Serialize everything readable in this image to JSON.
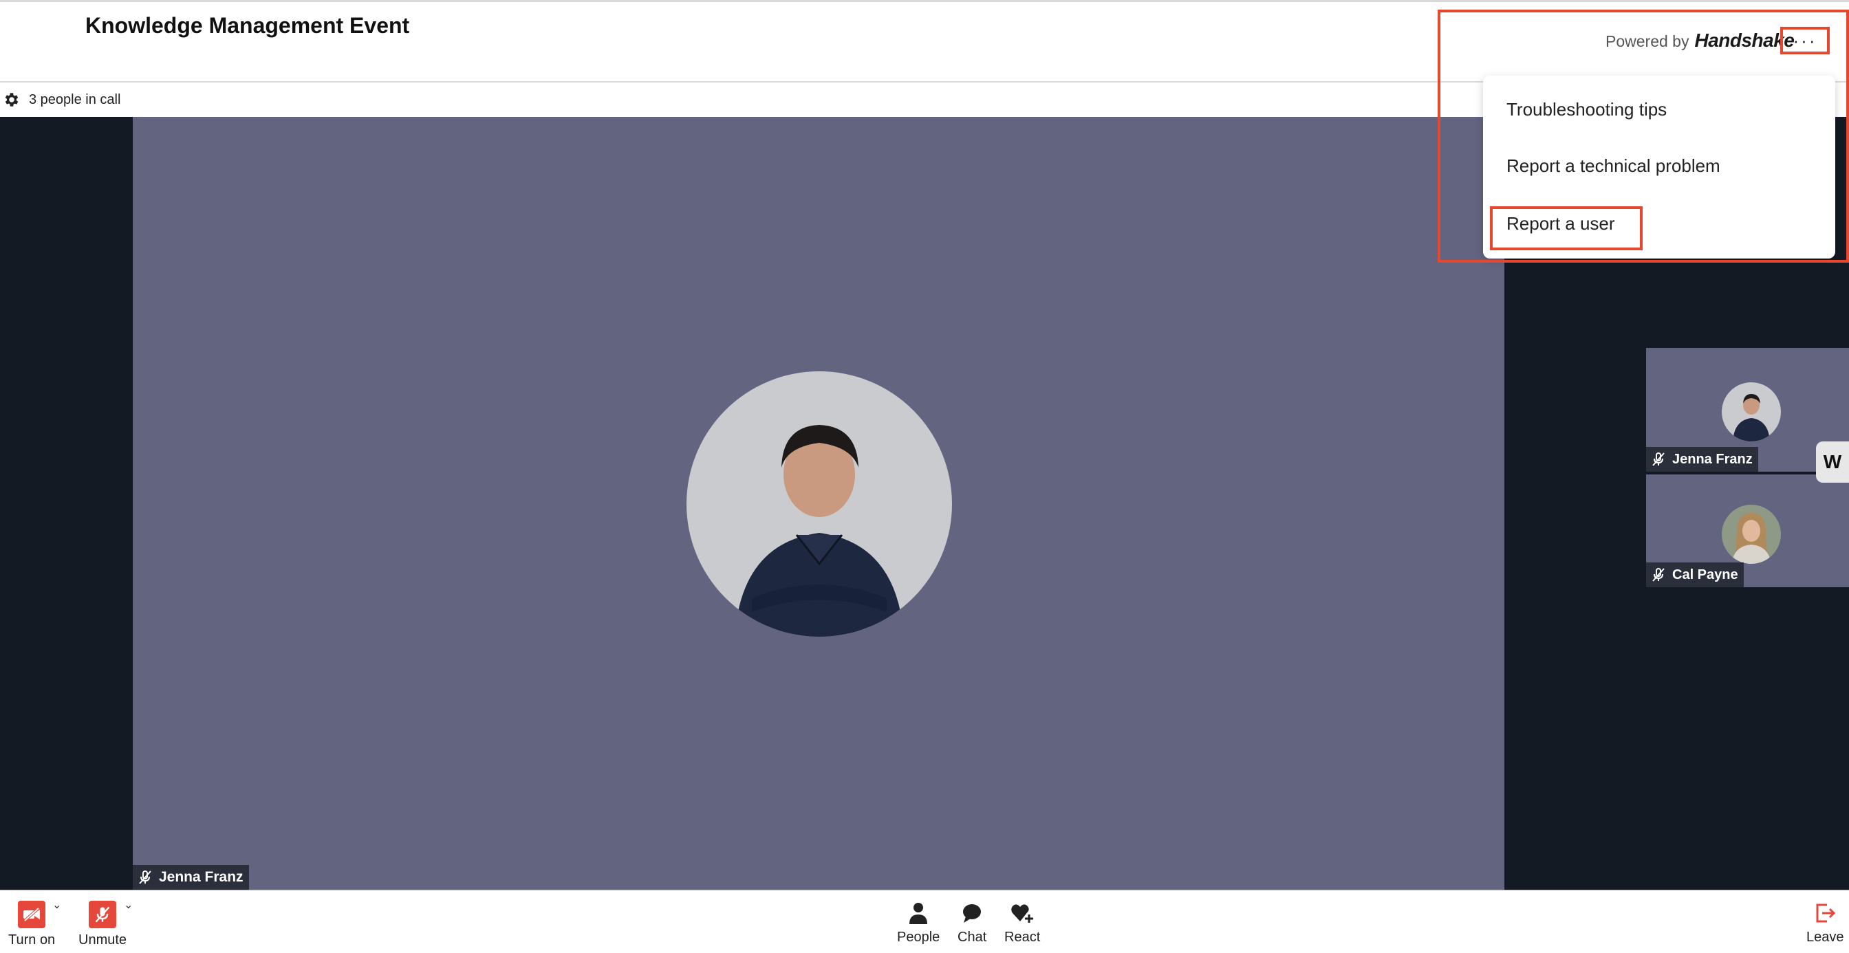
{
  "header": {
    "title": "Knowledge Management Event",
    "powered_by": "Powered by",
    "brand": "Handshake",
    "more_label": "···"
  },
  "status": {
    "people_count": "3 people in call"
  },
  "menu": {
    "items": [
      {
        "label": "Troubleshooting tips"
      },
      {
        "label": "Report a technical problem"
      },
      {
        "label": "Report a user"
      }
    ]
  },
  "participants": {
    "main": {
      "name": "Jenna Franz"
    },
    "tiles": [
      {
        "name": "Jenna Franz"
      },
      {
        "name": "Cal Payne"
      }
    ]
  },
  "side_widget": {
    "label": "W"
  },
  "controls": {
    "camera_label": "Turn on",
    "mic_label": "Unmute",
    "people_label": "People",
    "chat_label": "Chat",
    "react_label": "React",
    "leave_label": "Leave"
  },
  "colors": {
    "accent_red": "#e5472f",
    "stage_bg": "#141a24",
    "video_bg": "#636480"
  }
}
